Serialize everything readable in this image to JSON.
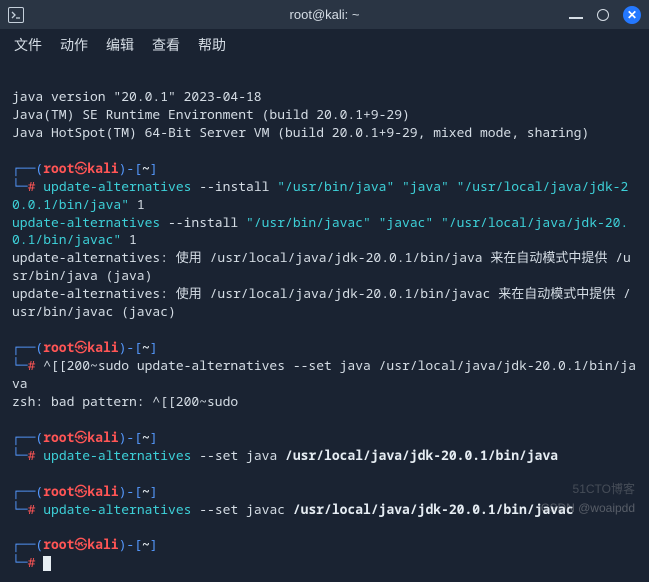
{
  "window": {
    "title": "root@kali: ~"
  },
  "menu": {
    "file": "文件",
    "actions": "动作",
    "edit": "编辑",
    "view": "查看",
    "help": "帮助"
  },
  "prompt": {
    "open": "┌──(",
    "root": "root",
    "at": "㉿",
    "host": "kali",
    "close1": ")-[",
    "path": "~",
    "close2": "]",
    "line2": "└─",
    "hash": "#"
  },
  "output": {
    "java_version": "java version \"20.0.1\" 2023-04-18",
    "java_runtime": "Java(TM) SE Runtime Environment (build 20.0.1+9-29)",
    "java_hotspot": "Java HotSpot(TM) 64-Bit Server VM (build 20.0.1+9-29, mixed mode, sharing)",
    "cmd1_a": "update-alternatives",
    "cmd1_b": " --install ",
    "cmd1_c": "\"/usr/bin/java\" \"java\" \"/usr/local/java/jdk-20.0.1/bin/java\"",
    "cmd1_d": " 1",
    "cmd2_a": "update-alternatives",
    "cmd2_b": " --install ",
    "cmd2_c": "\"/usr/bin/javac\" \"javac\" \"/usr/local/java/jdk-20.0.1/bin/javac\"",
    "cmd2_d": " 1",
    "result1": "update-alternatives: 使用 /usr/local/java/jdk-20.0.1/bin/java 来在自动模式中提供 /usr/bin/java (java)",
    "result2": "update-alternatives: 使用 /usr/local/java/jdk-20.0.1/bin/javac 来在自动模式中提供 /usr/bin/javac (javac)",
    "cmd3": "^[[200~sudo update-alternatives --set java /usr/local/java/jdk-20.0.1/bin/java",
    "err3": "zsh: bad pattern: ^[[200~sudo",
    "cmd4_a": "update-alternatives",
    "cmd4_b": " --set java ",
    "cmd4_c": "/usr/local/java/jdk-20.0.1/bin/java",
    "cmd5_a": "update-alternatives",
    "cmd5_b": " --set javac ",
    "cmd5_c": "/usr/local/java/jdk-20.0.1/bin/javac"
  },
  "watermark": {
    "w1": "51CTO博客",
    "w2": "CSDN @woaipdd"
  }
}
